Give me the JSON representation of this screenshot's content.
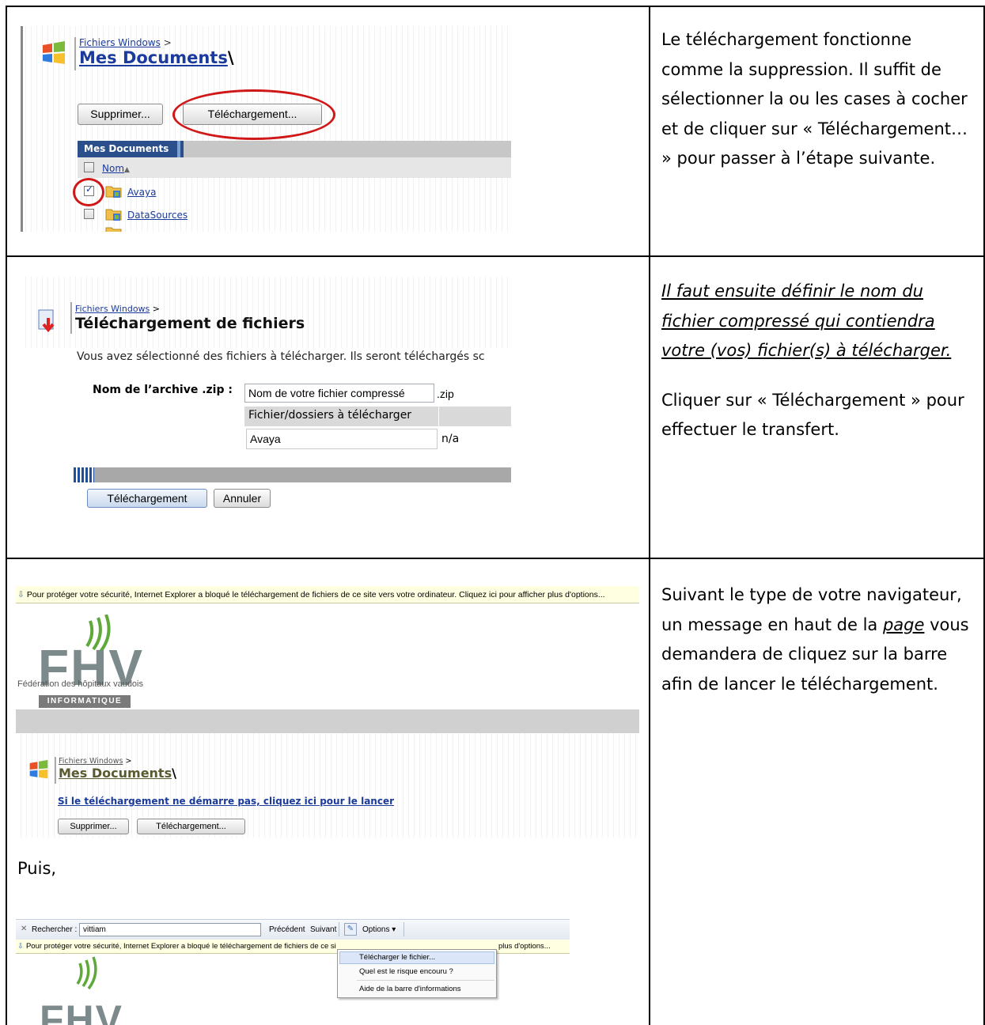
{
  "row1": {
    "breadcrumb": "Fichiers Windows",
    "breadcrumb_sep": ">",
    "title": "Mes Documents",
    "title_suffix": "\\",
    "btn_delete": "Supprimer...",
    "btn_download": "Téléchargement...",
    "grid_header": "Mes Documents",
    "col_name": "Nom",
    "rows": [
      "Avaya",
      "DataSources"
    ],
    "note": "Le téléchargement fonctionne comme la suppression. Il suffit de sélectionner la ou les cases à cocher et de cliquer sur « Téléchargement… » pour passer à l’étape suivante."
  },
  "row2": {
    "breadcrumb": "Fichiers Windows",
    "breadcrumb_sep": ">",
    "title": "Téléchargement de fichiers",
    "intro": "Vous avez sélectionné des fichiers à télécharger. Ils seront téléchargés sc",
    "archive_label": "Nom de l’archive .zip :",
    "archive_value": "Nom de votre fichier compressé",
    "archive_ext": ".zip",
    "files_header": "Fichier/dossiers à télécharger",
    "file_name": "Avaya",
    "file_size": "n/a",
    "btn_download": "Téléchargement",
    "btn_cancel": "Annuler",
    "note_italic": "Il faut ensuite définir le nom du fichier compressé qui contiendra votre (vos) fichier(s) à télécharger.",
    "note": "Cliquer sur « Téléchargement » pour effectuer le transfert."
  },
  "row3": {
    "ie_bar": "Pour protéger votre sécurité, Internet Explorer a bloqué le téléchargement de fichiers de ce site vers votre ordinateur. Cliquez ici pour afficher plus d'options...",
    "logo_text": "FHV",
    "org_name": "Fédération des hôpitaux vaudois",
    "org_dept": "INFORMATIQUE",
    "breadcrumb": "Fichiers Windows",
    "breadcrumb_sep": ">",
    "title": "Mes Documents",
    "title_suffix": "\\",
    "download_link": "Si le téléchargement ne démarre pas, cliquez ici pour le lancer",
    "btn_delete": "Supprimer...",
    "btn_download": "Téléchargement...",
    "puis": "Puis,",
    "search_label": "Rechercher :",
    "search_value": "vittiam",
    "prev": "Précédent",
    "next": "Suivant",
    "options": "Options",
    "ie_bar2_left": "Pour protéger votre sécurité, Internet Explorer a bloqué le téléchargement de fichiers de ce si",
    "ie_bar2_right": "plus d'options...",
    "menu": [
      "Télécharger le fichier...",
      "Quel est le risque encouru ?",
      "Aide de la barre d'informations"
    ],
    "note_a": "Suivant le type de votre navigateur, un message en haut de la ",
    "note_page": "page",
    "note_b": " vous demandera de cliquez sur la barre afin de lancer le téléchargement."
  }
}
